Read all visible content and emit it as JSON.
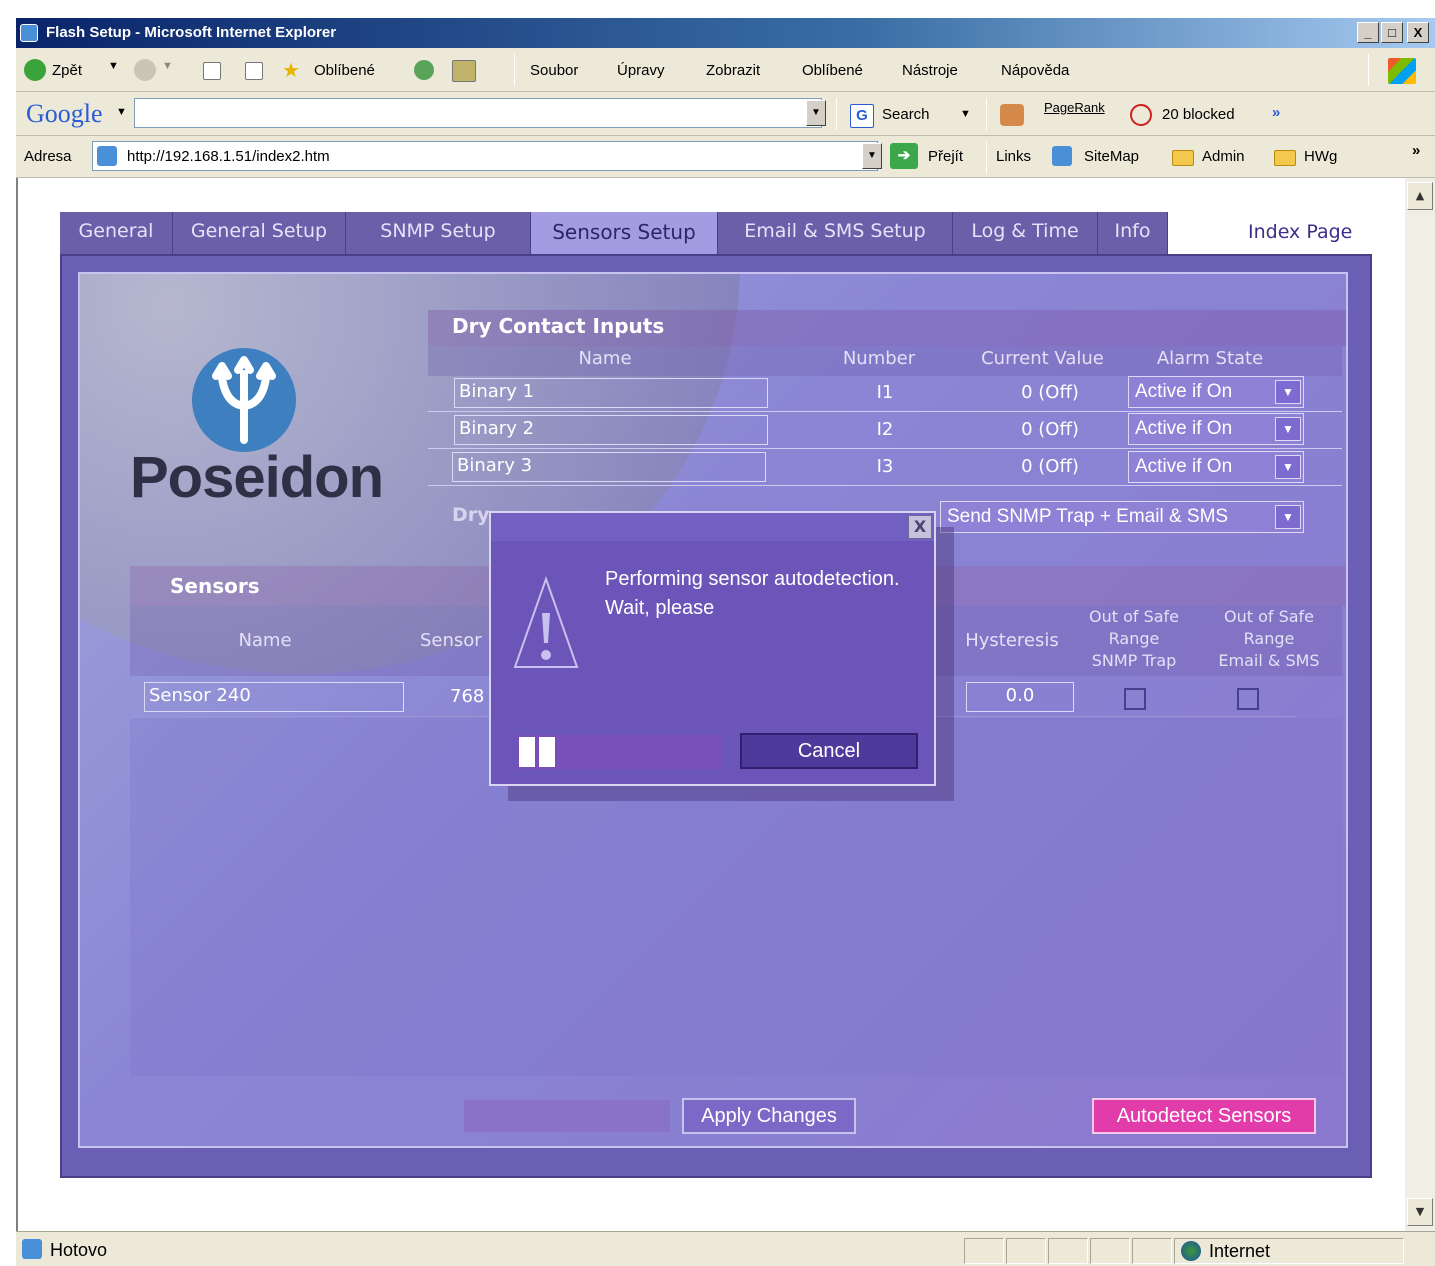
{
  "window": {
    "title": "Flash Setup - Microsoft Internet Explorer",
    "controls": [
      "_",
      "□",
      "X"
    ]
  },
  "menubar": {
    "back_label": "Zpět",
    "favorites_label": "Oblíbené",
    "menus": [
      "Soubor",
      "Úpravy",
      "Zobrazit",
      "Oblíbené",
      "Nástroje",
      "Nápověda"
    ]
  },
  "googlebar": {
    "logo": "Google",
    "search_value": "",
    "search_label": "Search",
    "pagerank_label": "PageRank",
    "blocked_label": "20 blocked",
    "more_label": "»"
  },
  "addressbar": {
    "label": "Adresa",
    "url": "http://192.168.1.51/index2.htm",
    "go_label": "Přejít",
    "links_label": "Links",
    "links": [
      "SiteMap",
      "Admin",
      "HWg"
    ],
    "more_label": "»"
  },
  "app": {
    "tabs": [
      "General",
      "General Setup",
      "SNMP Setup",
      "Sensors Setup",
      "Email & SMS Setup",
      "Log & Time",
      "Info"
    ],
    "active_tab": "Sensors Setup",
    "index_link": "Index Page",
    "logo_text": "Poseidon",
    "dry_contacts": {
      "title": "Dry Contact Inputs",
      "headers": [
        "Name",
        "Number",
        "Current Value",
        "Alarm State"
      ],
      "rows": [
        {
          "name": "Binary 1",
          "number": "I1",
          "value": "0 (Off)",
          "alarm": "Active if On"
        },
        {
          "name": "Binary 2",
          "number": "I2",
          "value": "0 (Off)",
          "alarm": "Active if On"
        },
        {
          "name": "Binary 3",
          "number": "I3",
          "value": "0 (Off)",
          "alarm": "Active if On"
        }
      ],
      "action_label_partial": "Dry",
      "action_value": "Send SNMP Trap + Email & SMS"
    },
    "sensors": {
      "title": "Sensors",
      "headers": {
        "name": "Name",
        "sensor": "Sensor",
        "hysteresis": "Hysteresis",
        "oos_snmp": [
          "Out of Safe",
          "Range",
          "SNMP Trap"
        ],
        "oos_email": [
          "Out of Safe",
          "Range",
          "Email & SMS"
        ]
      },
      "rows": [
        {
          "name": "Sensor 240",
          "id_partial": "768",
          "hysteresis": "0.0"
        }
      ]
    },
    "apply_button": "Apply Changes",
    "autodetect_button": "Autodetect Sensors",
    "colors": {
      "frame": "#6a5fb5",
      "panel": "#8a86d4",
      "autodetect": "#e23cab",
      "logo_blue": "#3d7fbf"
    }
  },
  "modal": {
    "close_label": "X",
    "message": "Performing sensor autodetection. Wait, please",
    "cancel_label": "Cancel",
    "progress_fraction": 0.1
  },
  "statusbar": {
    "status_text": "Hotovo",
    "zone_text": "Internet"
  }
}
